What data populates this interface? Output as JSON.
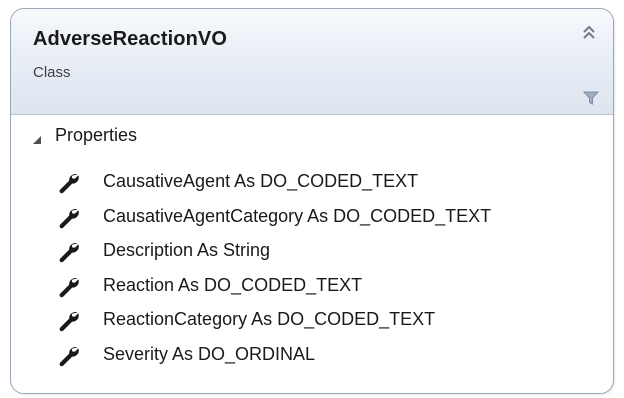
{
  "class_shape": {
    "name": "AdverseReactionVO",
    "kind": "Class",
    "collapse_icon": "double-chevron-up-icon",
    "filter_icon": "filter-funnel-icon"
  },
  "properties_section": {
    "title": "Properties",
    "expander_icon": "expanded-triangle-icon",
    "member_icon": "wrench-property-icon",
    "items": [
      {
        "label": "CausativeAgent As DO_CODED_TEXT"
      },
      {
        "label": "CausativeAgentCategory As DO_CODED_TEXT"
      },
      {
        "label": "Description As String"
      },
      {
        "label": "Reaction As DO_CODED_TEXT"
      },
      {
        "label": "ReactionCategory As DO_CODED_TEXT"
      },
      {
        "label": "Severity As DO_ORDINAL"
      }
    ]
  },
  "colors": {
    "header_gradient_top": "#f7f9fc",
    "header_gradient_bottom": "#dde5f0",
    "border": "#9aa7b6",
    "icon": "#1a1a1a",
    "filter_icon": "#8a9aae"
  }
}
